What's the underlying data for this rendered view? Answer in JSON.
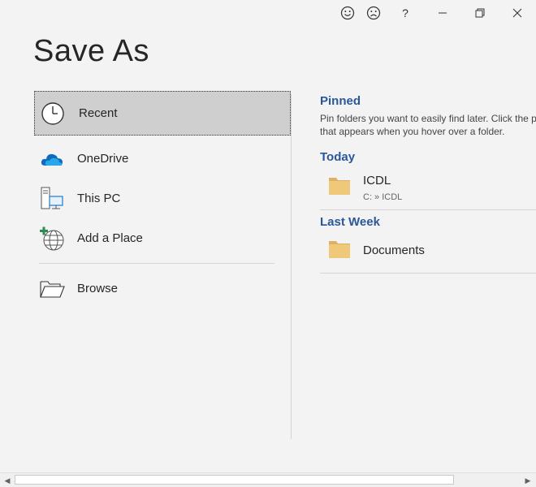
{
  "titlebar": {
    "smile_icon": "smile-icon",
    "frown_icon": "frown-icon",
    "help_label": "?",
    "minimize_icon": "minimize-icon",
    "restore_icon": "restore-icon",
    "close_icon": "close-icon"
  },
  "page": {
    "title": "Save As"
  },
  "nav": {
    "items": [
      {
        "label": "Recent",
        "icon": "clock-icon",
        "selected": true
      },
      {
        "label": "OneDrive",
        "icon": "cloud-icon"
      },
      {
        "label": "This PC",
        "icon": "computer-icon"
      },
      {
        "label": "Add a Place",
        "icon": "globe-add-icon"
      },
      {
        "label": "Browse",
        "icon": "open-folder-icon"
      }
    ]
  },
  "right": {
    "pinned": {
      "heading": "Pinned",
      "description_line1": "Pin folders you want to easily find later. Click the p",
      "description_line2": "that appears when you hover over a folder."
    },
    "today": {
      "heading": "Today",
      "folders": [
        {
          "name": "ICDL",
          "path": "C: » ICDL"
        }
      ]
    },
    "last_week": {
      "heading": "Last Week",
      "folders": [
        {
          "name": "Documents",
          "path": ""
        }
      ]
    }
  },
  "colors": {
    "accent": "#2b579a",
    "folder": "#f0c87a",
    "onedrive": "#0f6cbd",
    "selected_bg": "#cfcfcf"
  }
}
